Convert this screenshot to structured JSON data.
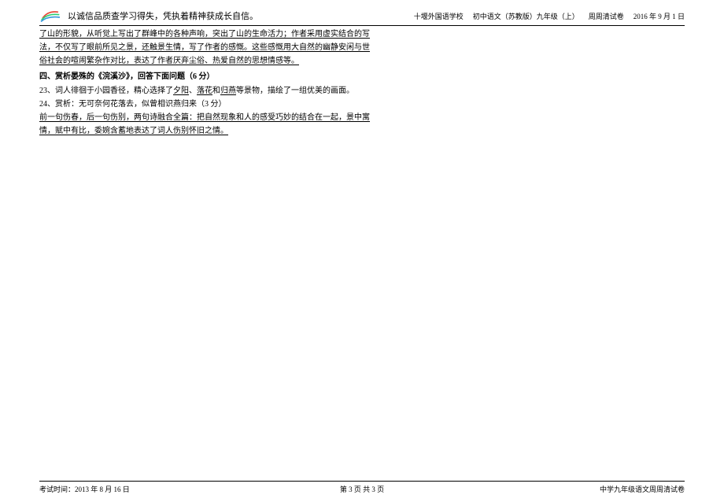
{
  "header": {
    "motto": "以诚信品质查学习得失，凭执着精神获成长自信。",
    "school": "十堰外国语学校",
    "course": "初中语文（苏教版）九年级（上）",
    "exam_type": "周周清试卷",
    "date": "2016 年 9 月 1 日"
  },
  "body": {
    "passage1_line1": "了山的形貌，从听觉上写出了群峰中的各种声响，突出了山的生命活力；作者采用虚实结合的写",
    "passage1_line2": "法，不仅写了眼前所见之景，还触景生情，写了作者的感慨。这些感慨用大自然的幽静安闲与世",
    "passage1_line3": "俗社会的喧闹繁杂作对比，表达了作者厌弃尘俗、热爱自然的思想情感等。",
    "section4_title": "四、赏析晏殊的《浣溪沙》，回答下面问题（6 分）",
    "q23_prefix": "23、词人徘徊于小园香径，精心选择了",
    "q23_blank1": "夕阳",
    "q23_sep1": "、",
    "q23_blank2": "落花",
    "q23_sep2": "和",
    "q23_blank3": "归燕",
    "q23_suffix": "等景物，描绘了一组优美的画面。",
    "q24": "24、赏析：无可奈何花落去，似曾相识燕归来（3 分）",
    "q24_ans_line1": "前一句伤春，后一句伤别，两句诗融合全篇：把自然现象和人的感受巧妙的结合在一起，景中寓",
    "q24_ans_line2": "情，赋中有比，委婉含蓄地表达了词人伤别怀旧之情。"
  },
  "footer": {
    "left": "考试时间：2013 年 8 月 16 日",
    "center": "第 3 页 共 3 页",
    "right": "中学九年级语文周周清试卷"
  }
}
